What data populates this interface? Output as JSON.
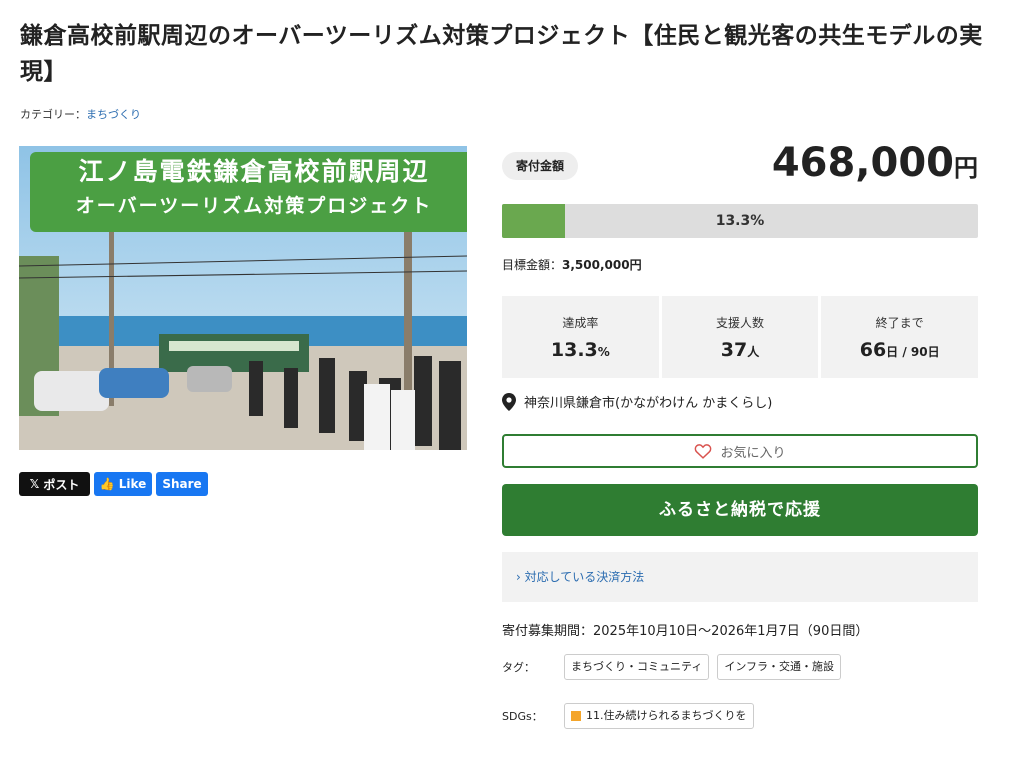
{
  "project": {
    "title": "鎌倉高校前駅周辺のオーバーツーリズム対策プロジェクト【住民と観光客の共生モデルの実現】",
    "category_label": "カテゴリー：",
    "category_value": "まちづくり"
  },
  "hero": {
    "banner_line1": "江ノ島電鉄鎌倉高校前駅周辺",
    "banner_line2": "オーバーツーリズム対策プロジェクト"
  },
  "share": {
    "x_label": "ポスト",
    "like_label": "Like",
    "share_label": "Share"
  },
  "donation": {
    "badge": "寄付金額",
    "amount": "468,000",
    "amount_unit": "円",
    "progress_text": "13.3%",
    "progress_fraction": 0.133,
    "goal_label": "目標金額：",
    "goal_value": "3,500,000円"
  },
  "stats": {
    "rate_label": "達成率",
    "rate_value": "13.3",
    "rate_unit": "%",
    "supporters_label": "支援人数",
    "supporters_value": "37",
    "supporters_unit": "人",
    "remaining_label": "終了まで",
    "remaining_value": "66",
    "remaining_unit": "日 / 90日"
  },
  "location": {
    "icon": "map-pin-icon",
    "text": "神奈川県鎌倉市(かながわけん かまくらし)"
  },
  "actions": {
    "favorite_label": "お気に入り",
    "donate_label": "ふるさと納税で応援",
    "payment_label": "対応している決済方法"
  },
  "period": {
    "text": "寄付募集期間：2025年10月10日～2026年1月7日（90日間）"
  },
  "tags": {
    "label": "タグ：",
    "items": [
      "まちづくり・コミュニティ",
      "インフラ・交通・施設"
    ]
  },
  "sdgs": {
    "label": "SDGs：",
    "items": [
      "11.住み続けられるまちづくりを"
    ]
  },
  "colors": {
    "primary_green": "#2f7d32",
    "progress_green": "#6aa84f",
    "link_blue": "#2b6cb0",
    "facebook_blue": "#1877f2"
  }
}
